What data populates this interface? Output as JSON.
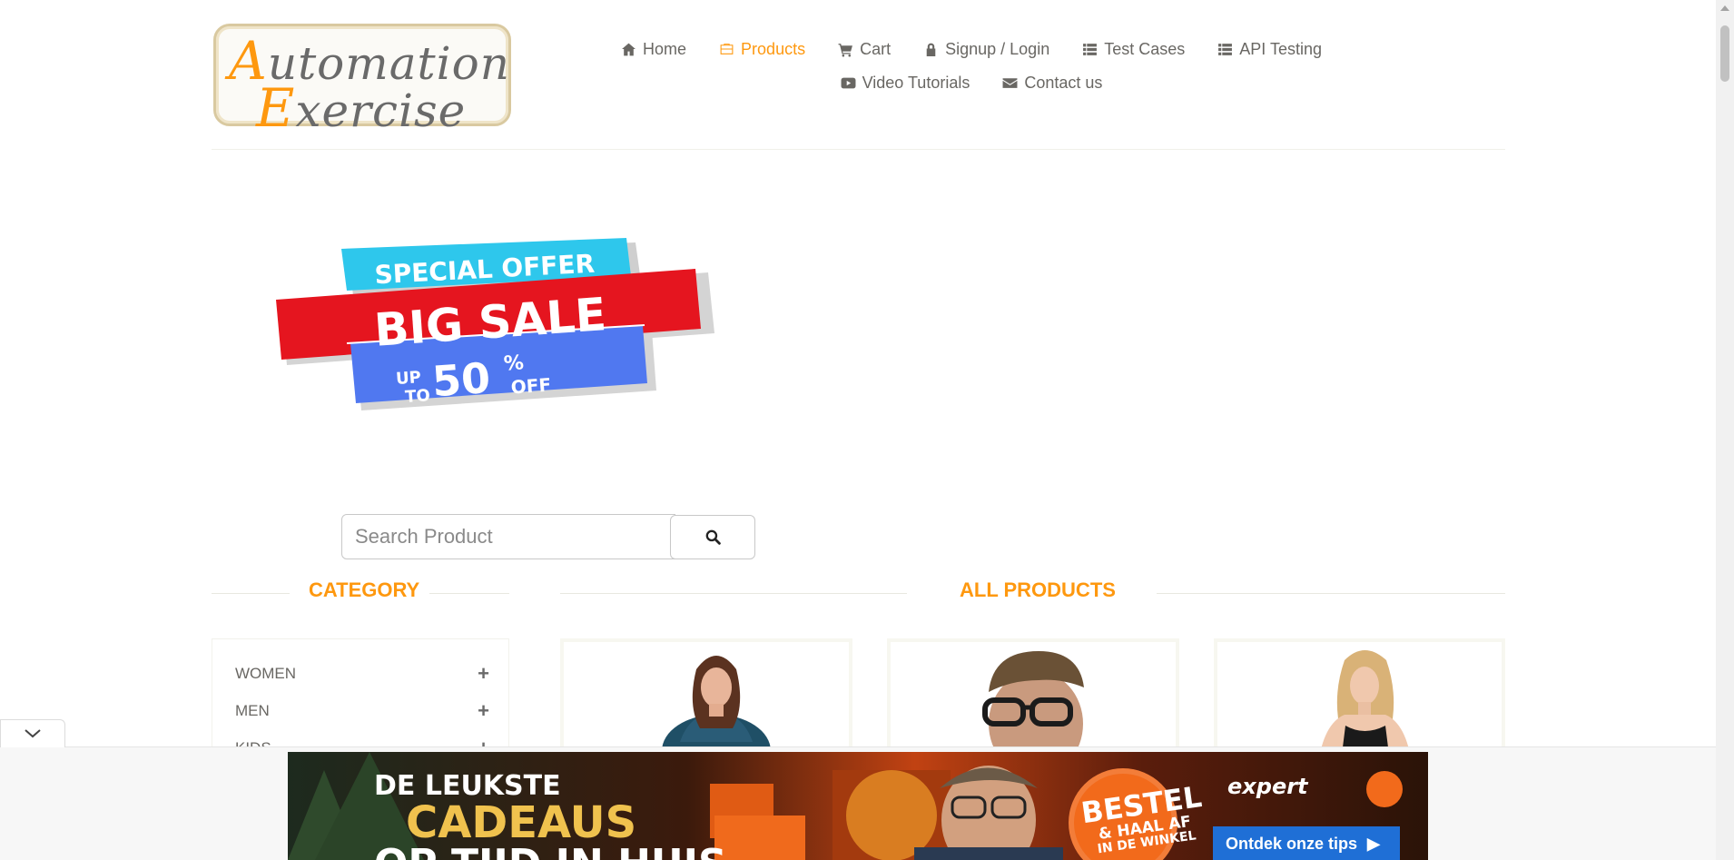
{
  "logo": {
    "line1": "Automation",
    "line2": "Exercise",
    "cap1": "A",
    "rest1": "utomation",
    "cap2": "E",
    "rest2": "xercise"
  },
  "nav": {
    "row1": [
      {
        "label": "Home",
        "icon": "home-icon",
        "active": false
      },
      {
        "label": "Products",
        "icon": "products-icon",
        "active": true
      },
      {
        "label": "Cart",
        "icon": "cart-icon",
        "active": false
      },
      {
        "label": "Signup / Login",
        "icon": "lock-icon",
        "active": false
      },
      {
        "label": "Test Cases",
        "icon": "list-icon",
        "active": false
      },
      {
        "label": "API Testing",
        "icon": "list-icon",
        "active": false
      }
    ],
    "row2": [
      {
        "label": "Video Tutorials",
        "icon": "youtube-icon",
        "active": false
      },
      {
        "label": "Contact us",
        "icon": "envelope-icon",
        "active": false
      }
    ]
  },
  "banner": {
    "line1": "SPECIAL OFFER",
    "line2": "BIG SALE",
    "up": "UP",
    "to": "TO",
    "percent": "50",
    "pct_sign": "%",
    "off": "OFF"
  },
  "search": {
    "placeholder": "Search Product",
    "value": ""
  },
  "category": {
    "title": "CATEGORY",
    "items": [
      {
        "label": "WOMEN",
        "expand": "+"
      },
      {
        "label": "MEN",
        "expand": "+"
      },
      {
        "label": "KIDS",
        "expand": "+"
      }
    ]
  },
  "products": {
    "title": "ALL PRODUCTS"
  },
  "ad": {
    "headline1": "DE LEUKSTE",
    "headline2": "CADEAUS",
    "headline3": "OP TIJD IN HUIS",
    "badge_line1": "BESTEL",
    "badge_line2": "& HAAL AF",
    "badge_line3": "IN DE WINKEL",
    "brand": "expert",
    "cta": "Ontdek onze tips",
    "cta_icon": "play-icon"
  },
  "colors": {
    "accent": "#fe980f",
    "text": "#696763",
    "ad_cta": "#1f6fd6"
  }
}
